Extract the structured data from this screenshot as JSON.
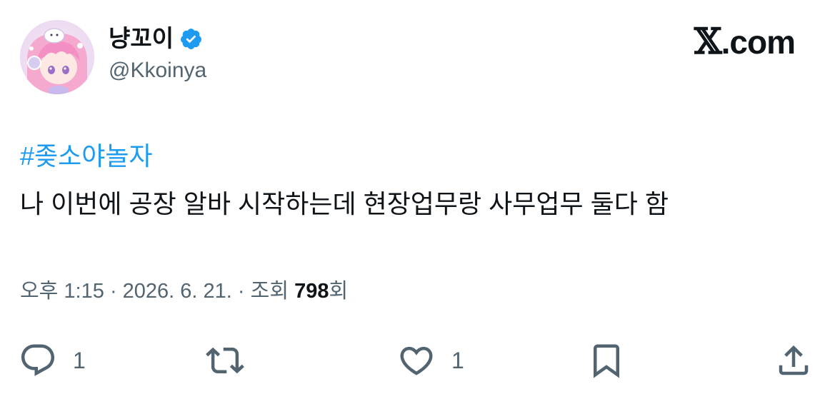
{
  "author": {
    "display_name": "냥꼬이",
    "handle": "@Kkoinya",
    "verified_icon": "verified-badge-icon",
    "avatar": "avatar-illustration-pink-hair-girl"
  },
  "brand": {
    "x_mark": "𝕏",
    "suffix": ".com"
  },
  "tweet": {
    "hashtag": "#좆소야놀자",
    "text": "나 이번에 공장 알바 시작하는데 현장업무랑 사무업무 둘다 함"
  },
  "meta": {
    "time": "오후 1:15",
    "separator": "·",
    "date": "2026. 6. 21.",
    "views_label": "조회",
    "views_count": "798",
    "views_suffix": "회"
  },
  "actions": {
    "reply_count": "1",
    "like_count": "1",
    "icons": [
      "reply-icon",
      "retweet-icon",
      "like-icon",
      "bookmark-icon",
      "share-icon"
    ]
  },
  "colors": {
    "link": "#1d9bf0",
    "secondary_text": "#536471",
    "primary_text": "#0f1419",
    "verified": "#1d9bf0"
  }
}
